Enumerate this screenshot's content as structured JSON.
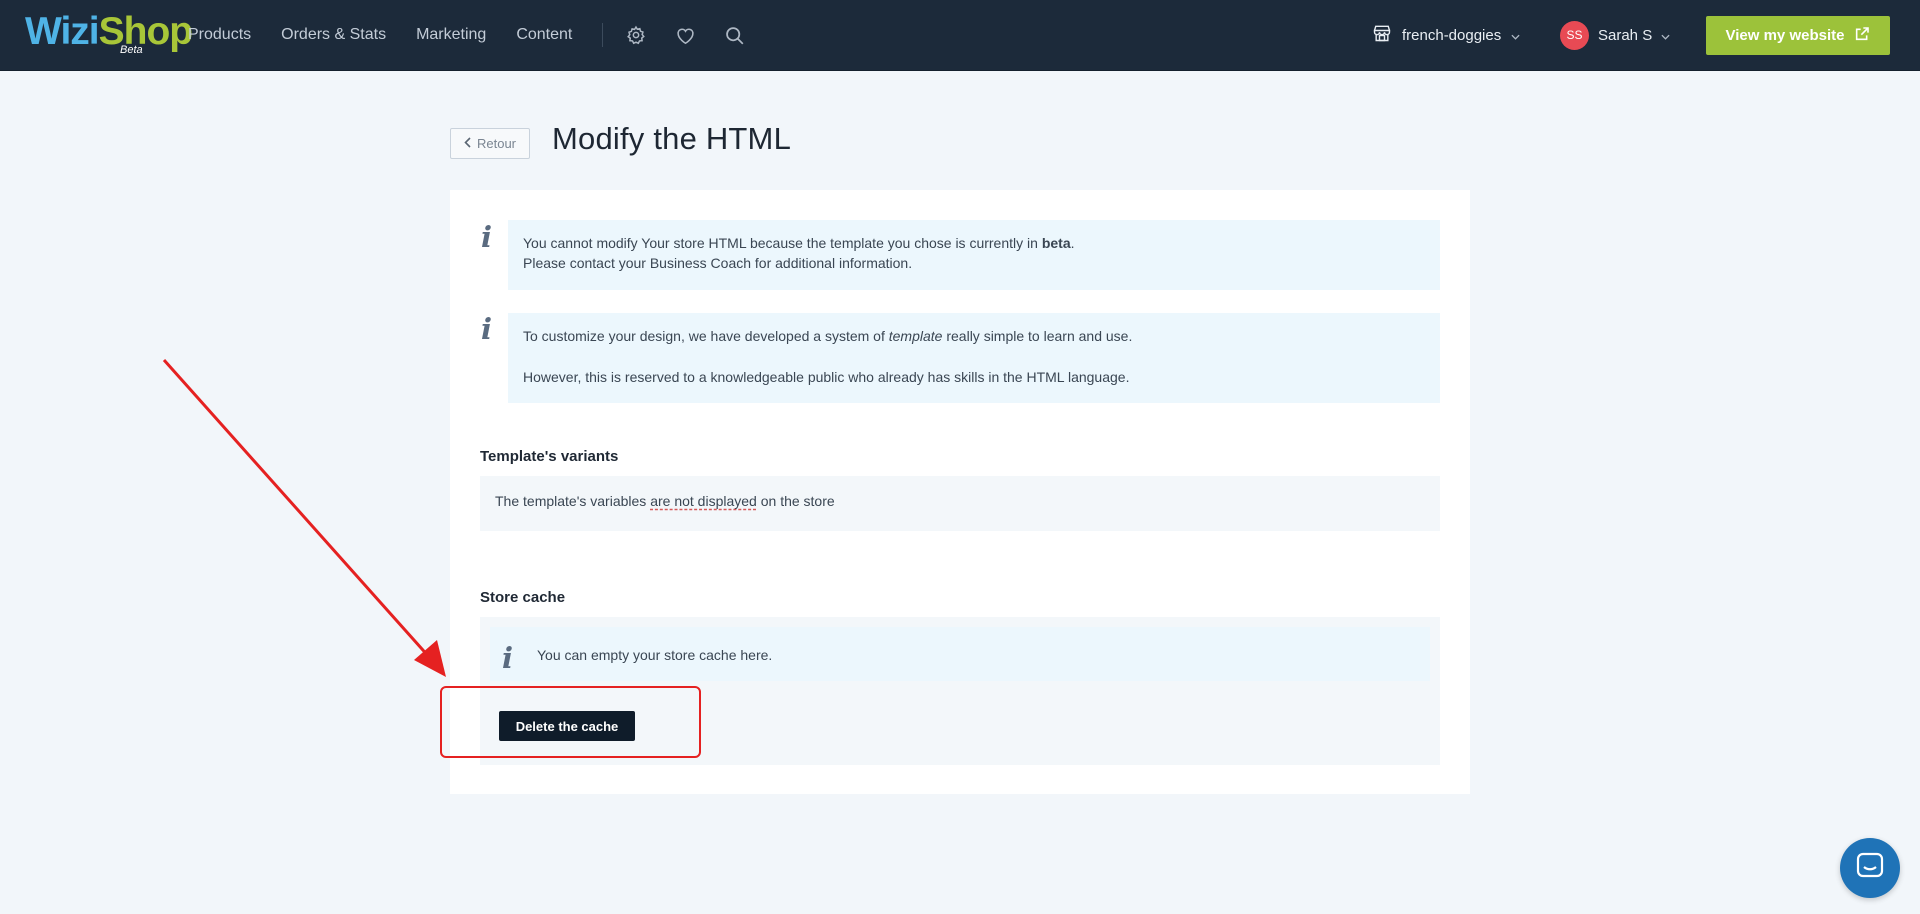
{
  "header": {
    "logo": {
      "part1": "Wizi",
      "part2": "Shop",
      "tag": "Beta"
    },
    "nav": [
      {
        "label": "Products"
      },
      {
        "label": "Orders & Stats"
      },
      {
        "label": "Marketing"
      },
      {
        "label": "Content"
      }
    ],
    "icons": [
      "gear-icon",
      "heart-icon",
      "search-icon"
    ],
    "store_selector": {
      "label": "french-doggies",
      "icon": "store-icon"
    },
    "user": {
      "initials": "SS",
      "name": "Sarah S"
    },
    "view_website_label": "View my website",
    "colors": {
      "topbar": "#1c2a3a",
      "accent_green": "#9cc23a",
      "logo_blue": "#4fb3e6"
    }
  },
  "page": {
    "back_label": "Retour",
    "title": "Modify the HTML"
  },
  "notices": {
    "beta": {
      "text_before": "You cannot modify Your store HTML because the template you chose is currently in ",
      "bold": "beta",
      "text_after": ".",
      "line2": "Please contact your Business Coach for additional information."
    },
    "template": {
      "line1_before": "To customize your design, we have developed a system of ",
      "line1_em": "template",
      "line1_after": " really simple to learn and use.",
      "line2": "However, this is reserved to a knowledgeable public who already has skills in the HTML language."
    }
  },
  "variants": {
    "title": "Template's variants",
    "text_before": "The template's variables ",
    "text_underlined": "are not displayed",
    "text_after": " on the store"
  },
  "cache": {
    "title": "Store cache",
    "info": "You can empty your store cache here.",
    "button_label": "Delete the cache"
  },
  "annotation": {
    "color": "#e52121"
  },
  "chat": {
    "icon": "chat-icon",
    "color": "#1f73b7"
  }
}
